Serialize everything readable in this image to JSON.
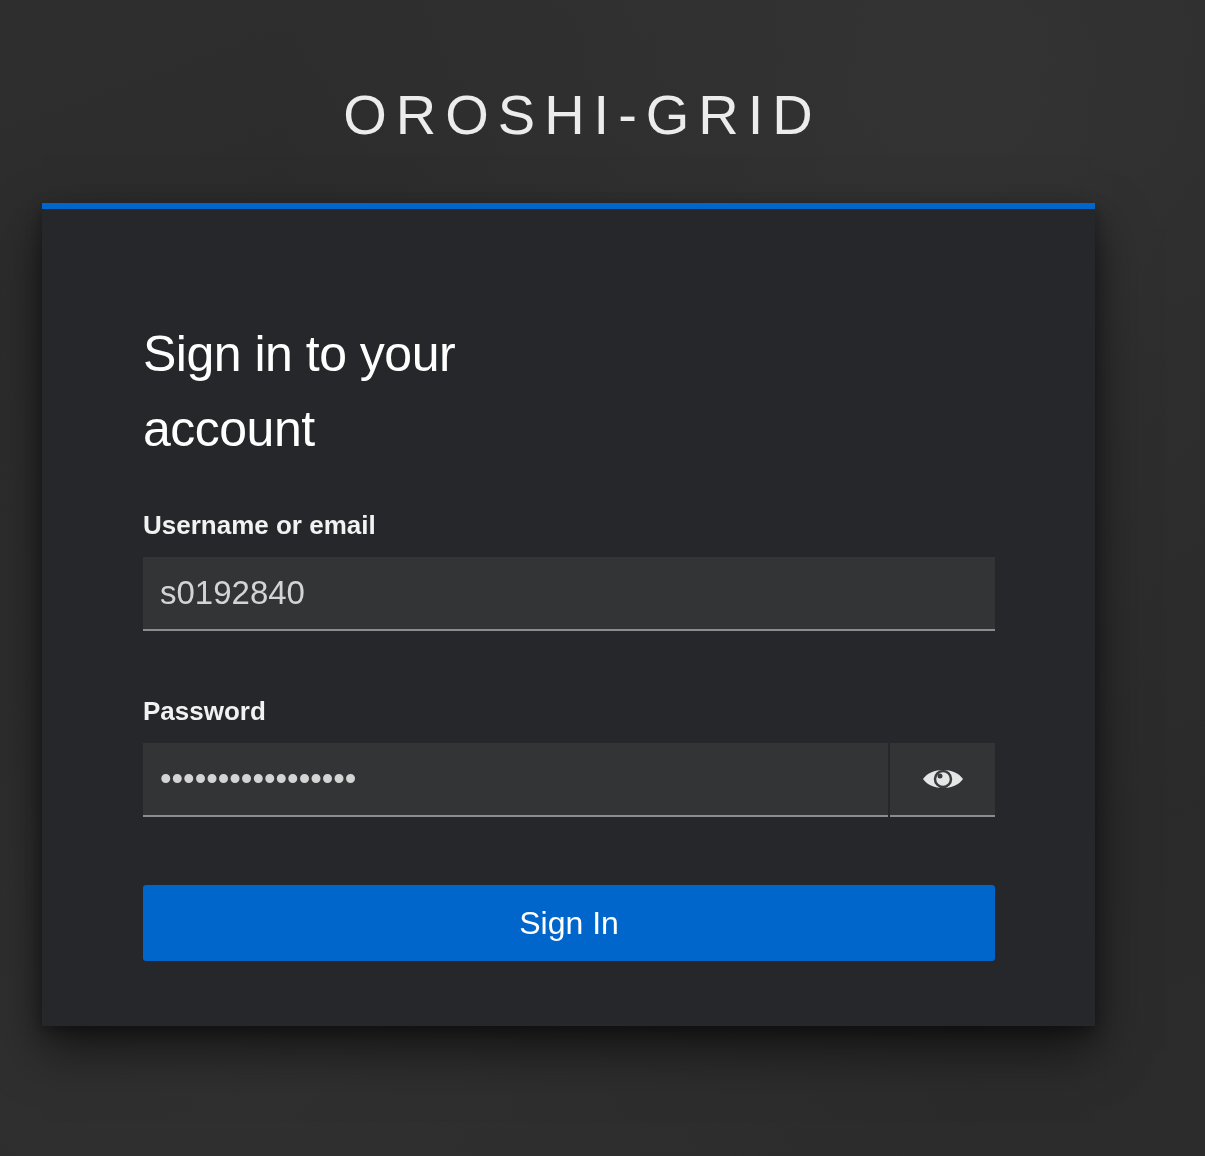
{
  "logo": {
    "text": "OROSHI-GRID"
  },
  "card": {
    "title": "Sign in to your account",
    "fields": [
      {
        "kind": "text",
        "label": "Username or email",
        "value": "s0192840"
      },
      {
        "kind": "password",
        "label": "Password",
        "value": "•••••••••••••••••"
      }
    ],
    "button": {
      "label": "Sign In"
    }
  }
}
